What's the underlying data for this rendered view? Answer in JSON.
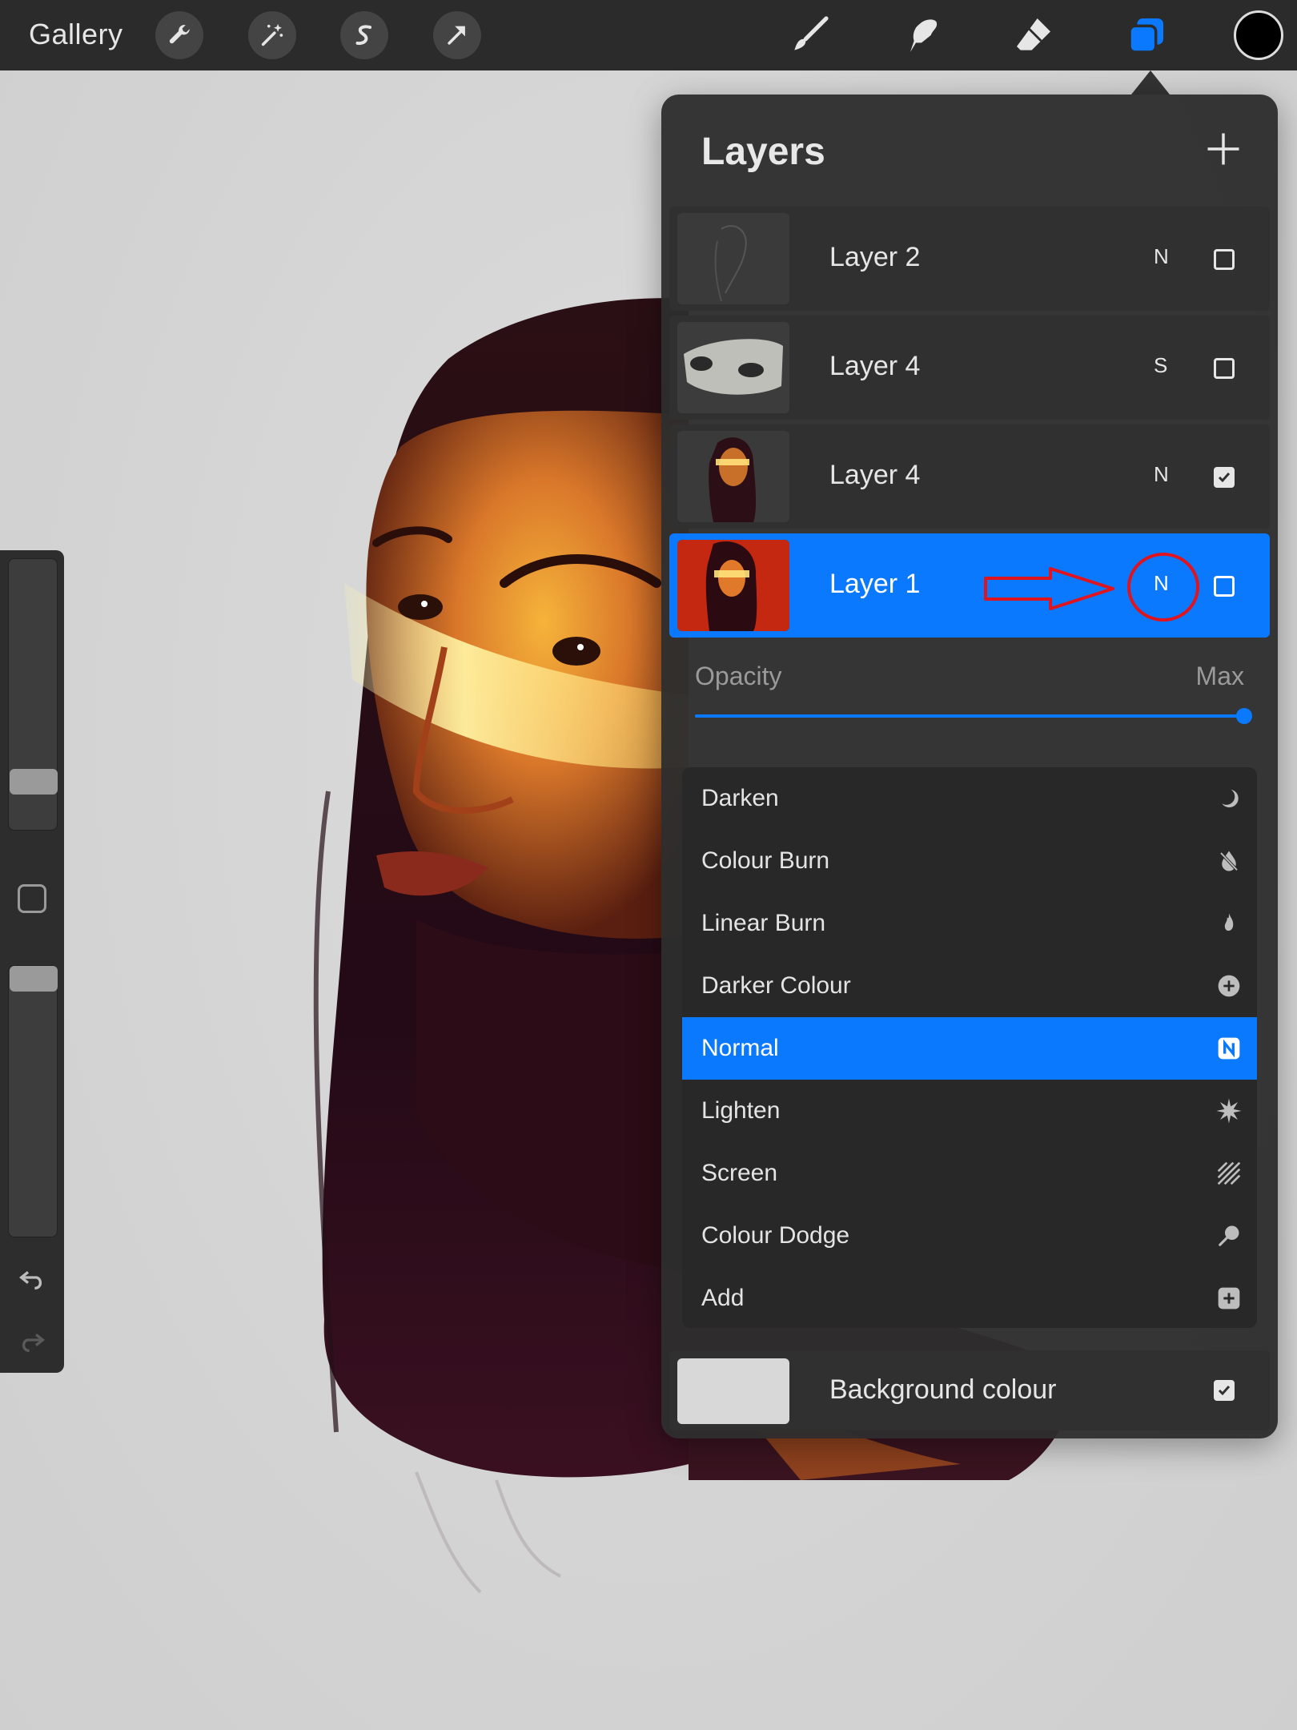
{
  "topbar": {
    "gallery_label": "Gallery",
    "left_tools": [
      "wrench-icon",
      "magic-wand-icon",
      "selection-icon",
      "transform-arrow-icon"
    ],
    "right_tools": [
      "brush-icon",
      "smudge-icon",
      "eraser-icon",
      "layers-icon"
    ],
    "active_tool": "layers-icon",
    "current_colour": "#000000"
  },
  "sidebar": {
    "size_slider_level": 0.8,
    "opacity_slider_level": 1.0
  },
  "layers_panel": {
    "title": "Layers",
    "layers": [
      {
        "name": "Layer 2",
        "blend": "N",
        "visible": false,
        "selected": false
      },
      {
        "name": "Layer 4",
        "blend": "S",
        "visible": false,
        "selected": false
      },
      {
        "name": "Layer 4",
        "blend": "N",
        "visible": true,
        "selected": false
      },
      {
        "name": "Layer 1",
        "blend": "N",
        "visible": false,
        "selected": true
      }
    ],
    "opacity": {
      "label": "Opacity",
      "value_label": "Max",
      "level": 1.0
    },
    "blend_modes": [
      {
        "label": "Darken",
        "icon": "moon-icon",
        "selected": false
      },
      {
        "label": "Colour Burn",
        "icon": "burn-drop-icon",
        "selected": false
      },
      {
        "label": "Linear Burn",
        "icon": "flame-icon",
        "selected": false
      },
      {
        "label": "Darker Colour",
        "icon": "plus-circle-icon",
        "selected": false
      },
      {
        "label": "Normal",
        "icon": "n-badge-icon",
        "selected": true
      },
      {
        "label": "Lighten",
        "icon": "starburst-icon",
        "selected": false
      },
      {
        "label": "Screen",
        "icon": "hatch-icon",
        "selected": false
      },
      {
        "label": "Colour Dodge",
        "icon": "dodge-icon",
        "selected": false
      },
      {
        "label": "Add",
        "icon": "plus-square-icon",
        "selected": false
      }
    ],
    "background": {
      "label": "Background colour",
      "colour": "#d8d8d8",
      "visible": true
    },
    "accent_colour": "#0a79fd"
  },
  "annotation": {
    "arrow_colour": "#e0141e"
  }
}
